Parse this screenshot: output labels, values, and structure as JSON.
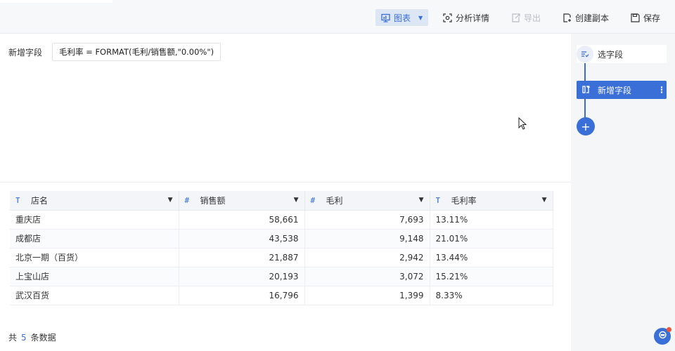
{
  "toolbar": {
    "chart_label": "图表",
    "analysis_label": "分析详情",
    "export_label": "导出",
    "copy_label": "创建副本",
    "save_label": "保存"
  },
  "editor": {
    "field_label": "新增字段",
    "formula": "毛利率 = FORMAT(毛利/销售额,\"0.00%\")"
  },
  "table": {
    "columns": [
      {
        "type": "T",
        "name": "店名"
      },
      {
        "type": "#",
        "name": "销售额"
      },
      {
        "type": "#",
        "name": "毛利"
      },
      {
        "type": "T",
        "name": "毛利率"
      }
    ],
    "rows": [
      [
        "重庆店",
        "58,661",
        "7,693",
        "13.11%"
      ],
      [
        "成都店",
        "43,538",
        "9,148",
        "21.01%"
      ],
      [
        "北京一期（百货）",
        "21,887",
        "2,942",
        "13.44%"
      ],
      [
        "上宝山店",
        "20,193",
        "3,072",
        "15.21%"
      ],
      [
        "武汉百货",
        "16,796",
        "1,399",
        "8.33%"
      ]
    ]
  },
  "footer": {
    "prefix": "共",
    "count": "5",
    "suffix": "条数据"
  },
  "steps": {
    "select_fields": "选字段",
    "new_field": "新增字段"
  },
  "colors": {
    "accent": "#3a6fd8"
  }
}
